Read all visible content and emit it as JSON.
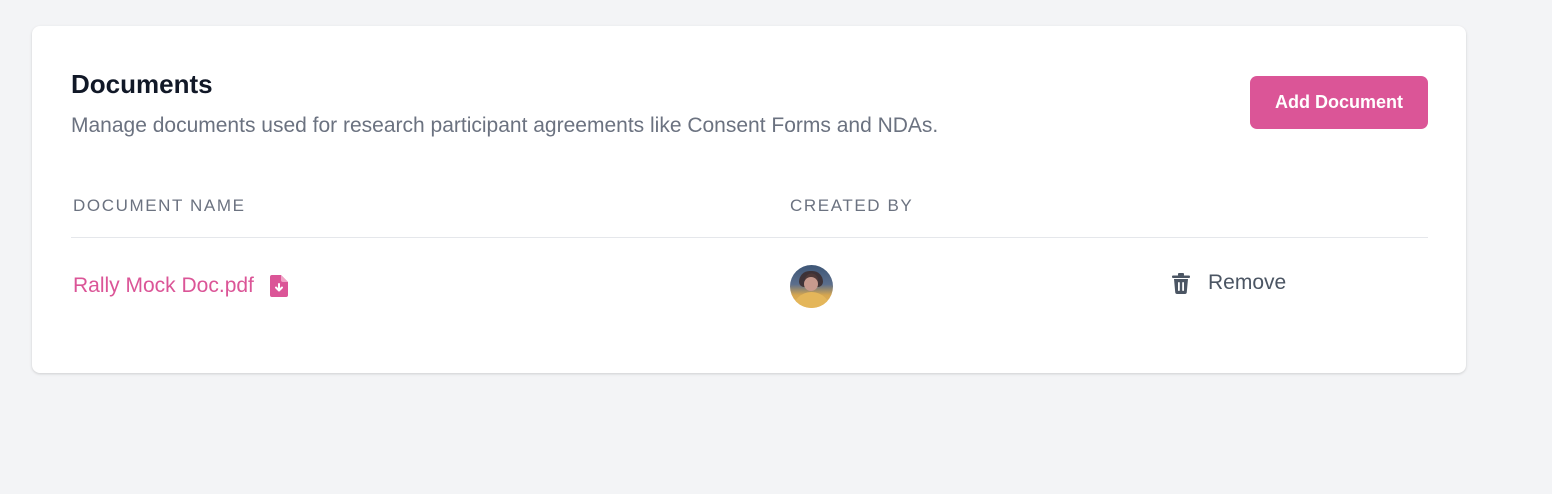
{
  "documents_card": {
    "title": "Documents",
    "description": "Manage documents used for research participant agreements like Consent Forms and NDAs.",
    "add_button_label": "Add Document"
  },
  "table": {
    "columns": [
      "DOCUMENT NAME",
      "CREATED BY"
    ],
    "rows": [
      {
        "document_name": "Rally Mock Doc.pdf",
        "document_icon": "file-download-icon",
        "created_by_avatar": "avatar",
        "action_label": "Remove",
        "action_icon": "trash-icon"
      }
    ]
  },
  "colors": {
    "accent": "#db5597",
    "background": "#f3f4f6",
    "card": "#ffffff",
    "muted_text": "#6b7280",
    "heading_text": "#111827"
  }
}
